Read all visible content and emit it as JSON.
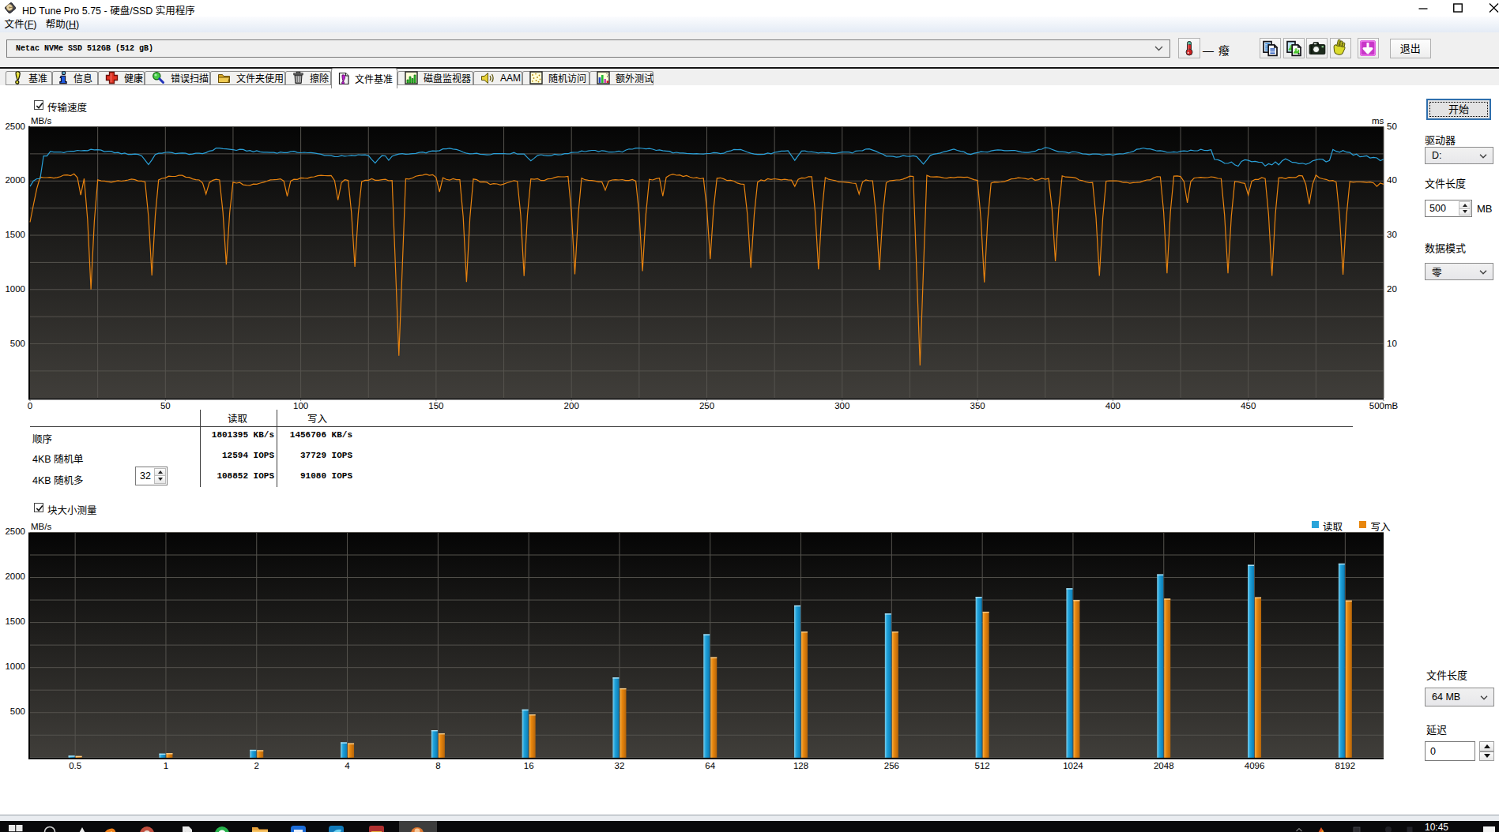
{
  "window": {
    "title": "HD Tune Pro 5.75 - 硬盘/SSD 实用程序",
    "controls": {
      "minimize": "minimize",
      "maximize": "maximize",
      "close": "close"
    }
  },
  "menu": {
    "file": "文件(F)",
    "help": "帮助(H)"
  },
  "toolbar": {
    "drive_combo_value": "Netac NVMe SSD 512GB (512 gB)",
    "temperature_value": "— 癈",
    "exit_label": "退出",
    "icons": [
      "thermometer-icon",
      "copy-text-icon",
      "copy-image-icon",
      "camera-icon",
      "hand-icon",
      "save-download-icon"
    ]
  },
  "tabs": [
    {
      "label": "基准",
      "icon": "benchmark-icon",
      "active": false
    },
    {
      "label": "信息",
      "icon": "info-icon",
      "active": false
    },
    {
      "label": "健康",
      "icon": "health-icon",
      "active": false
    },
    {
      "label": "错误扫描",
      "icon": "error-scan-icon",
      "active": false
    },
    {
      "label": "文件夹使用",
      "icon": "folder-usage-icon",
      "active": false
    },
    {
      "label": "擦除",
      "icon": "erase-icon",
      "active": false
    },
    {
      "label": "文件基准",
      "icon": "file-benchmark-icon",
      "active": true
    },
    {
      "label": "磁盘监视器",
      "icon": "disk-monitor-icon",
      "active": false
    },
    {
      "label": "AAM",
      "icon": "aam-icon",
      "active": false
    },
    {
      "label": "随机访问",
      "icon": "random-access-icon",
      "active": false
    },
    {
      "label": "额外测试",
      "icon": "extra-tests-icon",
      "active": false
    }
  ],
  "transfer_section": {
    "checkbox_label": "传输速度",
    "checked": true,
    "y_unit": "MB/s",
    "right_unit": "ms"
  },
  "results_table": {
    "col_read": "读取",
    "col_write": "写入",
    "rows": [
      {
        "label": "顺序",
        "read": "1801395 KB/s",
        "write": "1456706 KB/s"
      },
      {
        "label": "4KB 随机单",
        "read": "12594 IOPS",
        "write": "37729 IOPS"
      },
      {
        "label": "4KB 随机多",
        "read": "108852 IOPS",
        "write": "91080 IOPS"
      }
    ],
    "queue_depth_value": "32"
  },
  "block_section": {
    "checkbox_label": "块大小测量",
    "checked": true,
    "y_unit": "MB/s",
    "legend_read": "读取",
    "legend_write": "写入"
  },
  "side_panel": {
    "start_button": "开始",
    "drive_label": "驱动器",
    "drive_value": "D:",
    "file_length_label": "文件长度",
    "file_length_value": "500",
    "file_length_unit": "MB",
    "data_mode_label": "数据模式",
    "data_mode_value": "零",
    "file_length2_label": "文件长度",
    "file_length2_value": "64 MB",
    "delay_label": "延迟",
    "delay_value": "0"
  },
  "taskbar": {
    "clock": "10:45"
  },
  "colors": {
    "read": "#2aa0d8",
    "write": "#e8830f",
    "chart_bg_top": "#050505",
    "chart_bg_bottom": "#403e3a",
    "grid": "#55534e"
  },
  "chart_data": [
    {
      "type": "line",
      "title": "传输速度",
      "xlabel_ticks": [
        "0",
        "50",
        "100",
        "150",
        "200",
        "250",
        "300",
        "350",
        "400",
        "450",
        "500mB"
      ],
      "x_range_mb": [
        0,
        500
      ],
      "ylabel": "MB/s",
      "ylim": [
        0,
        2500
      ],
      "y_ticks": [
        2500,
        2000,
        1500,
        1000,
        500
      ],
      "right_axis_label": "ms",
      "right_ylim": [
        0,
        50
      ],
      "right_ticks": [
        50,
        40,
        30,
        20,
        10
      ],
      "grid_x_step_mb": 25,
      "grid_y_step": 250,
      "x_step_mb": 1.25,
      "series": [
        {
          "name": "读取",
          "color": "#2aa0d8",
          "values": [
            1950,
            2000,
            2020,
            2020,
            2230,
            2230,
            2271,
            2266,
            2266,
            2267,
            2261,
            2271,
            2274,
            2273,
            2282,
            2278,
            2281,
            2280,
            2291,
            2287,
            2288,
            2285,
            2270,
            2274,
            2274,
            2259,
            2262,
            2250,
            2257,
            2244,
            2245,
            2248,
            2245,
            2231,
            2192,
            2150,
            2194,
            2244,
            2255,
            2256,
            2264,
            2265,
            2261,
            2251,
            2255,
            2257,
            2255,
            2244,
            2248,
            2256,
            2256,
            2252,
            2261,
            2276,
            2281,
            2303,
            2302,
            2297,
            2296,
            2292,
            2288,
            2282,
            2291,
            2290,
            2276,
            2281,
            2269,
            2279,
            2269,
            2265,
            2265,
            2262,
            2262,
            2255,
            2266,
            2261,
            2261,
            2270,
            2273,
            2263,
            2260,
            2264,
            2260,
            2261,
            2258,
            2251,
            2246,
            2235,
            2235,
            2233,
            2225,
            2224,
            2233,
            2229,
            2231,
            2236,
            2232,
            2242,
            2240,
            2241,
            2234,
            2197,
            2165,
            2203,
            2233,
            2231,
            2190,
            2228,
            2240,
            2248,
            2252,
            2247,
            2248,
            2251,
            2254,
            2262,
            2266,
            2257,
            2272,
            2277,
            2276,
            2279,
            2296,
            2295,
            2301,
            2294,
            2290,
            2280,
            2266,
            2255,
            2250,
            2251,
            2255,
            2247,
            2245,
            2241,
            2242,
            2251,
            2252,
            2252,
            2253,
            2249,
            2250,
            2262,
            2248,
            2248,
            2249,
            2215,
            2185,
            2210,
            2236,
            2242,
            2235,
            2232,
            2233,
            2246,
            2241,
            2243,
            2252,
            2251,
            2262,
            2264,
            2265,
            2277,
            2271,
            2277,
            2282,
            2282,
            2270,
            2280,
            2275,
            2266,
            2266,
            2269,
            2275,
            2266,
            2284,
            2294,
            2293,
            2302,
            2304,
            2300,
            2296,
            2299,
            2293,
            2282,
            2287,
            2279,
            2276,
            2273,
            2258,
            2264,
            2258,
            2258,
            2254,
            2252,
            2250,
            2251,
            2249,
            2248,
            2253,
            2253,
            2261,
            2259,
            2251,
            2255,
            2272,
            2277,
            2290,
            2288,
            2290,
            2278,
            2265,
            2256,
            2248,
            2244,
            2244,
            2246,
            2257,
            2250,
            2264,
            2268,
            2275,
            2276,
            2280,
            2234,
            2190,
            2234,
            2276,
            2277,
            2267,
            2269,
            2264,
            2258,
            2264,
            2259,
            2261,
            2254,
            2254,
            2260,
            2266,
            2267,
            2266,
            2257,
            2276,
            2278,
            2279,
            2294,
            2296,
            2285,
            2274,
            2258,
            2248,
            2229,
            2229,
            2226,
            2219,
            2223,
            2233,
            2229,
            2226,
            2232,
            2225,
            2190,
            2155,
            2194,
            2234,
            2247,
            2251,
            2258,
            2269,
            2275,
            2284,
            2293,
            2282,
            2274,
            2268,
            2250,
            2245,
            2256,
            2261,
            2270,
            2267,
            2266,
            2277,
            2283,
            2287,
            2284,
            2280,
            2279,
            2281,
            2282,
            2274,
            2266,
            2262,
            2262,
            2268,
            2273,
            2290,
            2293,
            2309,
            2304,
            2291,
            2279,
            2269,
            2268,
            2266,
            2258,
            2269,
            2267,
            2260,
            2250,
            2248,
            2243,
            2248,
            2248,
            2247,
            2238,
            2244,
            2247,
            2238,
            2247,
            2250,
            2249,
            2257,
            2264,
            2272,
            2291,
            2295,
            2304,
            2295,
            2296,
            2287,
            2277,
            2279,
            2273,
            2264,
            2264,
            2268,
            2264,
            2274,
            2277,
            2273,
            2284,
            2278,
            2278,
            2292,
            2282,
            2281,
            2288,
            2198,
            2195,
            2183,
            2163,
            2162,
            2176,
            2149,
            2136,
            2181,
            2195,
            2190,
            2177,
            2181,
            2174,
            2173,
            2138,
            2158,
            2148,
            2176,
            2149,
            2185,
            2204,
            2189,
            2171,
            2170,
            2160,
            2163,
            2154,
            2163,
            2186,
            2193,
            2202,
            2199,
            2176,
            2189,
            2290,
            2273,
            2265,
            2281,
            2266,
            2263,
            2238,
            2248,
            2223,
            2226,
            2231,
            2212,
            2217,
            2213,
            2187,
            2200
          ]
        },
        {
          "name": "写入",
          "color": "#e8830f",
          "values": [
            1620,
            1780,
            1930,
            2036,
            2031,
            2031,
            2033,
            2026,
            2032,
            2040,
            2054,
            2056,
            2049,
            2065,
            2030,
            1870,
            2022,
            1647,
            1000,
            1633,
            2011,
            2001,
            1999,
            1993,
            1989,
            1996,
            2003,
            1998,
            2003,
            2009,
            2018,
            2011,
            2000,
            1999,
            1992,
            1673,
            1130,
            1681,
            2010,
            2024,
            2029,
            2044,
            2042,
            2042,
            2051,
            2051,
            2036,
            2034,
            2019,
            2012,
            2009,
            1981,
            1880,
            1986,
            2006,
            2016,
            2010,
            1714,
            1230,
            1709,
            1989,
            1980,
            1986,
            1965,
            1961,
            1960,
            1971,
            1970,
            1980,
            1988,
            1998,
            2010,
            2011,
            2014,
            2019,
            1999,
            1860,
            1999,
            2016,
            2014,
            2028,
            2026,
            2025,
            2035,
            2038,
            2048,
            2052,
            2049,
            2048,
            2050,
            2004,
            1824,
            1983,
            2011,
            2005,
            1705,
            1210,
            1699,
            1994,
            2006,
            2006,
            2021,
            2007,
            2007,
            2011,
            2015,
            2002,
            2004,
            1198,
            390,
            1197,
            2020,
            2018,
            2027,
            2044,
            2050,
            2054,
            2063,
            2052,
            2057,
            2032,
            1900,
            2030,
            2014,
            2008,
            2020,
            2012,
            2011,
            1667,
            1070,
            1661,
            2018,
            2012,
            1990,
            1992,
            1988,
            1968,
            1975,
            1973,
            1963,
            1972,
            1984,
            1993,
            2003,
            1997,
            1681,
            1125,
            1687,
            2019,
            2015,
            2021,
            2004,
            2005,
            2019,
            2020,
            2032,
            2039,
            2038,
            2038,
            2042,
            1710,
            1140,
            1694,
            2026,
            2011,
            2007,
            2004,
            1999,
            1992,
            1992,
            1915,
            1999,
            2009,
            2012,
            2009,
            2013,
            2004,
            2005,
            2013,
            1999,
            1694,
            1170,
            1694,
            2016,
            2009,
            2021,
            2026,
            1860,
            2033,
            2053,
            2062,
            2053,
            2055,
            2041,
            2050,
            2037,
            2027,
            2032,
            2020,
            2026,
            1748,
            1280,
            1748,
            2025,
            2029,
            2019,
            2004,
            2006,
            1998,
            1981,
            1972,
            1969,
            1688,
            1200,
            1692,
            1988,
            2009,
            2001,
            2020,
            2014,
            2020,
            2016,
            2010,
            2016,
            2010,
            2008,
            1950,
            2014,
            2028,
            2026,
            2040,
            2040,
            1722,
            1185,
            1715,
            2031,
            2015,
            2009,
            2003,
            1991,
            1991,
            1988,
            1985,
            1980,
            1977,
            1880,
            1990,
            2009,
            2002,
            2002,
            1694,
            1180,
            1689,
            1983,
            2001,
            2005,
            2009,
            2009,
            2017,
            2030,
            2045,
            2042,
            1179,
            300,
            1182,
            2052,
            2039,
            2037,
            2039,
            2035,
            2029,
            2026,
            2033,
            2030,
            2036,
            2036,
            2034,
            2036,
            2023,
            2012,
            2005,
            1644,
            1065,
            1637,
            1980,
            1990,
            1988,
            1991,
            1996,
            2006,
            2019,
            2021,
            2030,
            2027,
            2023,
            2016,
            2026,
            2007,
            2012,
            2024,
            2015,
            2023,
            1748,
            1260,
            1750,
            2048,
            2037,
            2035,
            2034,
            2029,
            2009,
            2003,
            1991,
            1984,
            1986,
            1667,
            1126,
            1660,
            1998,
            2001,
            2001,
            2002,
            1997,
            1986,
            1987,
            1979,
            1985,
            1986,
            1989,
            1999,
            2009,
            2010,
            2028,
            2040,
            2038,
            1715,
            1149,
            1716,
            2045,
            2046,
            2041,
            1995,
            1800,
            1994,
            2027,
            2031,
            2034,
            2030,
            2031,
            2038,
            2034,
            2024,
            2022,
            1685,
            1149,
            1676,
            1995,
            1991,
            1982,
            1977,
            1870,
            1997,
            2014,
            2014,
            2031,
            2022,
            1690,
            1126,
            1693,
            2028,
            2030,
            2021,
            2033,
            2032,
            2032,
            2050,
            2046,
            1970,
            1787,
            1970,
            2054,
            2029,
            2020,
            2014,
            2001,
            2005,
            1989,
            1675,
            1137,
            1674,
            1993,
            1989,
            1991,
            1991,
            1990,
            1986,
            1990,
            1982,
            1950,
            1980,
            1970
          ]
        }
      ]
    },
    {
      "type": "bar",
      "title": "块大小测量",
      "categories": [
        "0.5",
        "1",
        "2",
        "4",
        "8",
        "16",
        "32",
        "64",
        "128",
        "256",
        "512",
        "1024",
        "2048",
        "4096",
        "8192"
      ],
      "ylabel": "MB/s",
      "ylim": [
        0,
        2500
      ],
      "grid_y_step": 250,
      "y_ticks": [
        2500,
        2000,
        1500,
        1000,
        500
      ],
      "series": [
        {
          "name": "读取",
          "color": "#2aa0d8",
          "values": [
            22,
            45,
            87,
            170,
            305,
            535,
            890,
            1370,
            1690,
            1600,
            1785,
            1880,
            2035,
            2140,
            2155
          ]
        },
        {
          "name": "写入",
          "color": "#e8830f",
          "values": [
            18,
            50,
            83,
            160,
            270,
            480,
            770,
            1115,
            1400,
            1400,
            1620,
            1750,
            1765,
            1780,
            1745
          ]
        }
      ],
      "legend_position": "top-right"
    }
  ]
}
